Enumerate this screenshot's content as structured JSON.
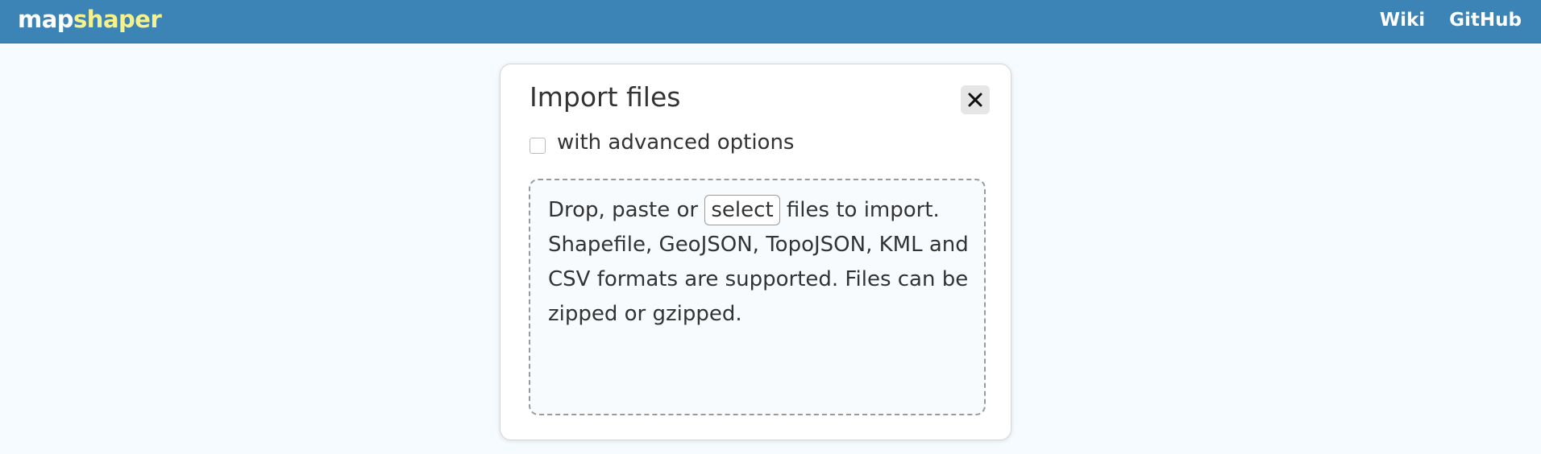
{
  "header": {
    "logo_part1": "map",
    "logo_part2": "shaper",
    "nav": [
      {
        "label": "Wiki"
      },
      {
        "label": "GitHub"
      }
    ],
    "background_color": "#3c83b6",
    "logo_accent_color": "#f6f28b"
  },
  "dialog": {
    "title": "Import files",
    "close_icon": "close-icon",
    "advanced_option_label": "with advanced options",
    "advanced_option_checked": false,
    "dropzone": {
      "text_before": "Drop, paste or ",
      "select_label": "select",
      "text_after": " files to import. Shapefile, GeoJSON, TopoJSON, KML and CSV formats are supported. Files can be zipped or gzipped."
    }
  }
}
